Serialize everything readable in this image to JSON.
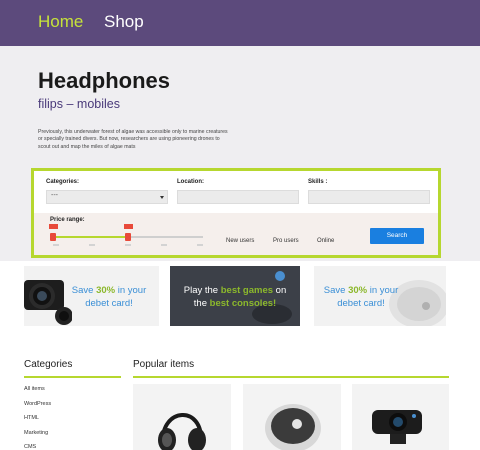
{
  "nav": {
    "home": "Home",
    "shop": "Shop"
  },
  "hero": {
    "title": "Headphones",
    "subtitle": "filips – mobiles",
    "description": "Previously, this underwater forest of algae was accessible only to marine creatures or specially trained divers. But now, researchers are using pioneering drones to scout out and map the miles of algae mats"
  },
  "filter": {
    "categories_label": "Categories:",
    "categories_value": "---",
    "location_label": "Location:",
    "location_value": "",
    "skills_label": "Skills :",
    "skills_value": "",
    "price_label": "Price range:",
    "price_min_tag": "",
    "price_max_tag": "",
    "price_range": [
      0.0,
      0.5
    ],
    "user_filters": [
      "New users",
      "Pro users",
      "Online"
    ],
    "search_label": "Search"
  },
  "promos": [
    {
      "pre": "Save ",
      "highlight": "30%",
      "mid": " in your",
      "line2": "debet card!",
      "theme": "light"
    },
    {
      "pre": "Play the ",
      "highlight": "best games",
      "mid": " on",
      "line2a": "the ",
      "line2b": "best consoles!",
      "theme": "dark"
    },
    {
      "pre": "Save ",
      "highlight": "30%",
      "mid": " in your",
      "line2": "debet card!",
      "theme": "light"
    }
  ],
  "categories": {
    "title": "Categories",
    "items": [
      "All items",
      "WordPress",
      "HTML",
      "Marketing",
      "CMS"
    ]
  },
  "popular": {
    "title": "Popular items"
  },
  "colors": {
    "nav_bg": "#5c4a7c",
    "accent": "#b6d72f",
    "subtitle": "#4a3a7a",
    "search_button": "#1a7fe0",
    "hero_bg": "#efeef1"
  },
  "icons": [
    "camera-lens-icon",
    "game-controller-icon",
    "smart-speaker-icon",
    "headphones-icon",
    "speaker-disc-icon",
    "webcam-icon"
  ]
}
